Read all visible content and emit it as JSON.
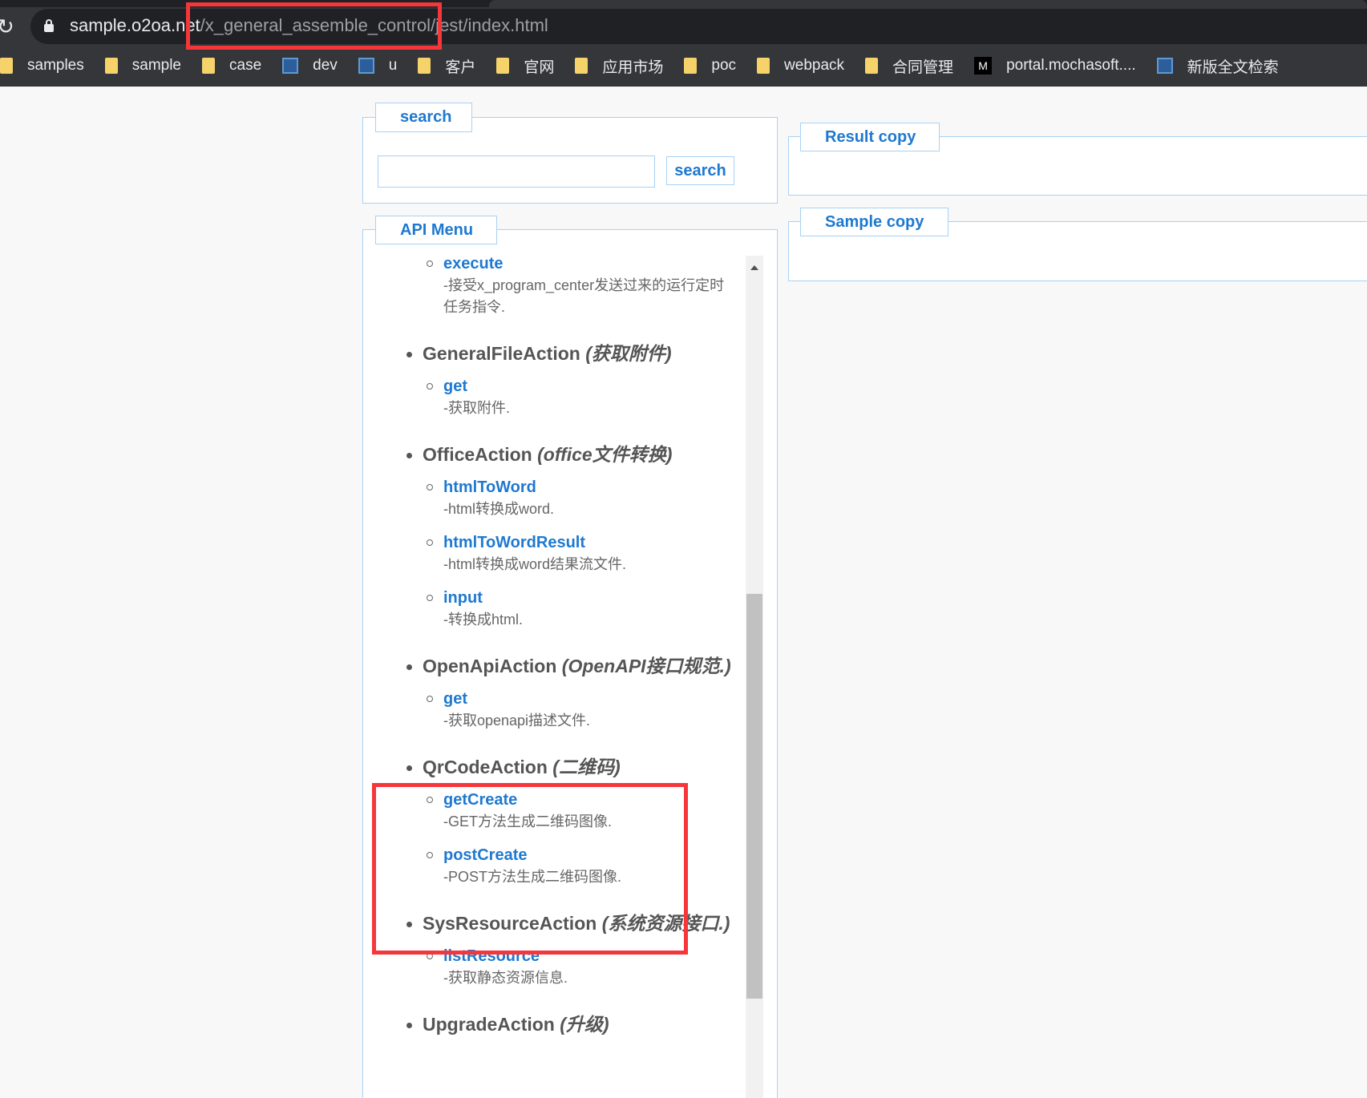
{
  "browser": {
    "url_host": "sample.o2oa.net",
    "url_path": "/x_general_assemble_control/jest/index.html",
    "bookmarks": [
      {
        "label": "samples",
        "icon": "folder-icon"
      },
      {
        "label": "sample",
        "icon": "folder-icon"
      },
      {
        "label": "case",
        "icon": "folder-icon"
      },
      {
        "label": "dev",
        "icon": "site-icon"
      },
      {
        "label": "u",
        "icon": "site-icon"
      },
      {
        "label": "客户",
        "icon": "folder-icon"
      },
      {
        "label": "官网",
        "icon": "folder-icon"
      },
      {
        "label": "应用市场",
        "icon": "folder-icon"
      },
      {
        "label": "poc",
        "icon": "folder-icon"
      },
      {
        "label": "webpack",
        "icon": "folder-icon"
      },
      {
        "label": "合同管理",
        "icon": "folder-icon"
      },
      {
        "label": "portal.mochasoft....",
        "icon": "m-icon",
        "icon_text": "M"
      },
      {
        "label": "新版全文检索",
        "icon": "site-icon"
      }
    ]
  },
  "search": {
    "legend": "search",
    "input_value": "",
    "button_label": "search"
  },
  "api_menu": {
    "legend": "API Menu",
    "groups": [
      {
        "name": "",
        "note": "",
        "items": [
          {
            "name": "execute",
            "desc": "-接受x_program_center发送过来的运行定时任务指令."
          }
        ]
      },
      {
        "name": "GeneralFileAction",
        "note": "(获取附件)",
        "items": [
          {
            "name": "get",
            "desc": "-获取附件."
          }
        ]
      },
      {
        "name": "OfficeAction",
        "note": "(office文件转换)",
        "items": [
          {
            "name": "htmlToWord",
            "desc": "-html转换成word."
          },
          {
            "name": "htmlToWordResult",
            "desc": "-html转换成word结果流文件."
          },
          {
            "name": "input",
            "desc": "-转换成html."
          }
        ]
      },
      {
        "name": "OpenApiAction",
        "note": "(OpenAPI接口规范.)",
        "items": [
          {
            "name": "get",
            "desc": "-获取openapi描述文件."
          }
        ]
      },
      {
        "name": "QrCodeAction",
        "note": "(二维码)",
        "items": [
          {
            "name": "getCreate",
            "desc": "-GET方法生成二维码图像."
          },
          {
            "name": "postCreate",
            "desc": "-POST方法生成二维码图像."
          }
        ]
      },
      {
        "name": "SysResourceAction",
        "note": "(系统资源接口.)",
        "items": [
          {
            "name": "listResource",
            "desc": "-获取静态资源信息."
          }
        ]
      },
      {
        "name": "UpgradeAction",
        "note": "(升级)",
        "items": []
      }
    ]
  },
  "result": {
    "legend": "Result copy"
  },
  "sample": {
    "legend": "Sample copy"
  },
  "colors": {
    "accent": "#1e79d0",
    "border": "#a8d1f5",
    "highlight": "#f5363a"
  }
}
